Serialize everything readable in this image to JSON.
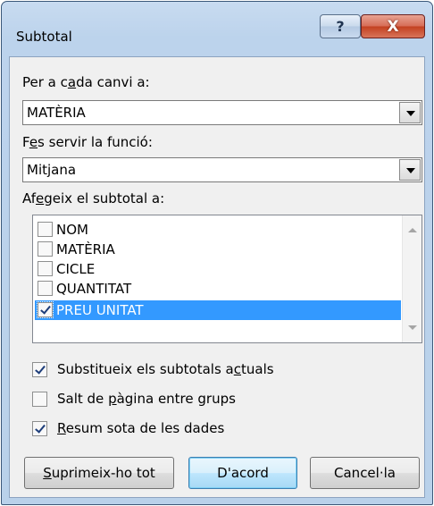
{
  "dialog": {
    "title": "Subtotal",
    "help_glyph": "?",
    "close_glyph": "X"
  },
  "group_by": {
    "label_pre": "Per a c",
    "label_key": "a",
    "label_post": "da canvi a:",
    "value": "MATÈRIA"
  },
  "function": {
    "label_pre": "F",
    "label_key": "e",
    "label_post": "s servir la funció:",
    "value": "Mitjana"
  },
  "add_subtotal": {
    "label_pre": "Af",
    "label_key": "e",
    "label_post": "geix el subtotal a:",
    "items": [
      {
        "label": "NOM",
        "checked": false,
        "selected": false
      },
      {
        "label": "MATÈRIA",
        "checked": false,
        "selected": false
      },
      {
        "label": "CICLE",
        "checked": false,
        "selected": false
      },
      {
        "label": "QUANTITAT",
        "checked": false,
        "selected": false
      },
      {
        "label": "PREU UNITAT",
        "checked": true,
        "selected": true
      }
    ]
  },
  "options": {
    "replace": {
      "pre": "Substitueix els subtotals a",
      "key": "c",
      "post": "tuals",
      "checked": true
    },
    "page_break": {
      "pre": "Salt de ",
      "key": "p",
      "post": "àgina entre grups",
      "checked": false
    },
    "summary": {
      "pre": "",
      "key": "R",
      "post": "esum sota de les dades",
      "checked": true
    }
  },
  "buttons": {
    "remove_all": {
      "key": "S",
      "post": "uprimeix-ho tot"
    },
    "ok": "D'acord",
    "cancel": "Cancel·la"
  }
}
